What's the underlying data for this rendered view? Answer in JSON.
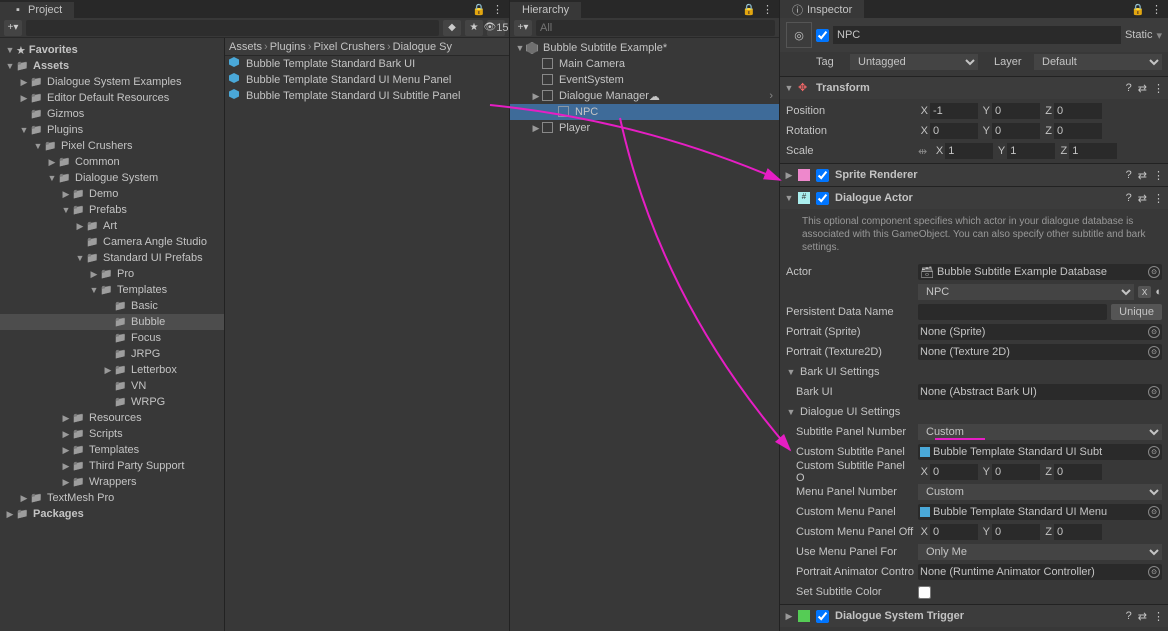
{
  "project": {
    "tab": "Project",
    "search_placeholder": "",
    "counts": "15",
    "favorites": "Favorites",
    "tree": [
      {
        "label": "Assets",
        "depth": 0,
        "open": true,
        "bold": true
      },
      {
        "label": "Dialogue System Examples",
        "depth": 1,
        "open": false
      },
      {
        "label": "Editor Default Resources",
        "depth": 1,
        "open": false
      },
      {
        "label": "Gizmos",
        "depth": 1,
        "leaf": true
      },
      {
        "label": "Plugins",
        "depth": 1,
        "open": true
      },
      {
        "label": "Pixel Crushers",
        "depth": 2,
        "open": true
      },
      {
        "label": "Common",
        "depth": 3,
        "open": false
      },
      {
        "label": "Dialogue System",
        "depth": 3,
        "open": true
      },
      {
        "label": "Demo",
        "depth": 4,
        "open": false
      },
      {
        "label": "Prefabs",
        "depth": 4,
        "open": true
      },
      {
        "label": "Art",
        "depth": 5,
        "open": false
      },
      {
        "label": "Camera Angle Studio",
        "depth": 5,
        "leaf": true
      },
      {
        "label": "Standard UI Prefabs",
        "depth": 5,
        "open": true
      },
      {
        "label": "Pro",
        "depth": 6,
        "open": false
      },
      {
        "label": "Templates",
        "depth": 6,
        "open": true
      },
      {
        "label": "Basic",
        "depth": 7,
        "leaf": true
      },
      {
        "label": "Bubble",
        "depth": 7,
        "leaf": true,
        "selected": true
      },
      {
        "label": "Focus",
        "depth": 7,
        "leaf": true
      },
      {
        "label": "JRPG",
        "depth": 7,
        "leaf": true
      },
      {
        "label": "Letterbox",
        "depth": 7,
        "open": false
      },
      {
        "label": "VN",
        "depth": 7,
        "leaf": true
      },
      {
        "label": "WRPG",
        "depth": 7,
        "leaf": true
      },
      {
        "label": "Resources",
        "depth": 4,
        "open": false
      },
      {
        "label": "Scripts",
        "depth": 4,
        "open": false
      },
      {
        "label": "Templates",
        "depth": 4,
        "open": false
      },
      {
        "label": "Third Party Support",
        "depth": 4,
        "open": false
      },
      {
        "label": "Wrappers",
        "depth": 4,
        "open": false
      },
      {
        "label": "TextMesh Pro",
        "depth": 1,
        "open": false
      },
      {
        "label": "Packages",
        "depth": 0,
        "open": false,
        "bold": true
      }
    ],
    "breadcrumb": [
      "Assets",
      "Plugins",
      "Pixel Crushers",
      "Dialogue Sy"
    ],
    "assets": [
      "Bubble Template Standard Bark UI",
      "Bubble Template Standard UI Menu Panel",
      "Bubble Template Standard UI Subtitle Panel"
    ]
  },
  "hierarchy": {
    "tab": "Hierarchy",
    "search_placeholder": "All",
    "items": [
      {
        "label": "Bubble Subtitle Example*",
        "depth": 0,
        "open": true,
        "scene": true
      },
      {
        "label": "Main Camera",
        "depth": 1
      },
      {
        "label": "EventSystem",
        "depth": 1
      },
      {
        "label": "Dialogue Manager",
        "depth": 1,
        "open": false,
        "link": true,
        "cloud": true
      },
      {
        "label": "NPC",
        "depth": 2,
        "selected": true
      },
      {
        "label": "Player",
        "depth": 1,
        "open": false
      }
    ]
  },
  "inspector": {
    "tab": "Inspector",
    "object_name": "NPC",
    "static": "Static",
    "tag_label": "Tag",
    "tag_value": "Untagged",
    "layer_label": "Layer",
    "layer_value": "Default",
    "transform": {
      "title": "Transform",
      "position_label": "Position",
      "position": {
        "x": "-1",
        "y": "0",
        "z": "0"
      },
      "rotation_label": "Rotation",
      "rotation": {
        "x": "0",
        "y": "0",
        "z": "0"
      },
      "scale_label": "Scale",
      "scale": {
        "x": "1",
        "y": "1",
        "z": "1"
      }
    },
    "sprite": {
      "title": "Sprite Renderer"
    },
    "dialogue_actor": {
      "title": "Dialogue Actor",
      "description": "This optional component specifies which actor in your dialogue database is associated with this GameObject. You can also specify other subtitle and bark settings.",
      "actor_label": "Actor",
      "actor_db": "Bubble Subtitle Example Database",
      "actor_value": "NPC",
      "persistent_label": "Persistent Data Name",
      "persistent_value": "",
      "unique_btn": "Unique",
      "portrait_sprite_label": "Portrait (Sprite)",
      "portrait_sprite_value": "None (Sprite)",
      "portrait_tex_label": "Portrait (Texture2D)",
      "portrait_tex_value": "None (Texture 2D)",
      "bark_settings": "Bark UI Settings",
      "bark_ui_label": "Bark UI",
      "bark_ui_value": "None (Abstract Bark UI)",
      "dlg_settings": "Dialogue UI Settings",
      "sub_panel_num_label": "Subtitle Panel Number",
      "sub_panel_num_value": "Custom",
      "custom_sub_panel_label": "Custom Subtitle Panel",
      "custom_sub_panel_value": "Bubble Template Standard UI Subt",
      "custom_sub_offset_label": "Custom Subtitle Panel O",
      "custom_sub_offset": {
        "x": "0",
        "y": "0",
        "z": "0"
      },
      "menu_panel_num_label": "Menu Panel Number",
      "menu_panel_num_value": "Custom",
      "custom_menu_panel_label": "Custom Menu Panel",
      "custom_menu_panel_value": "Bubble Template Standard UI Menu",
      "custom_menu_offset_label": "Custom Menu Panel Off",
      "custom_menu_offset": {
        "x": "0",
        "y": "0",
        "z": "0"
      },
      "use_menu_for_label": "Use Menu Panel For",
      "use_menu_for_value": "Only Me",
      "portrait_anim_label": "Portrait Animator Contro",
      "portrait_anim_value": "None (Runtime Animator Controller)",
      "set_sub_color_label": "Set Subtitle Color"
    },
    "trigger": {
      "title": "Dialogue System Trigger"
    }
  }
}
